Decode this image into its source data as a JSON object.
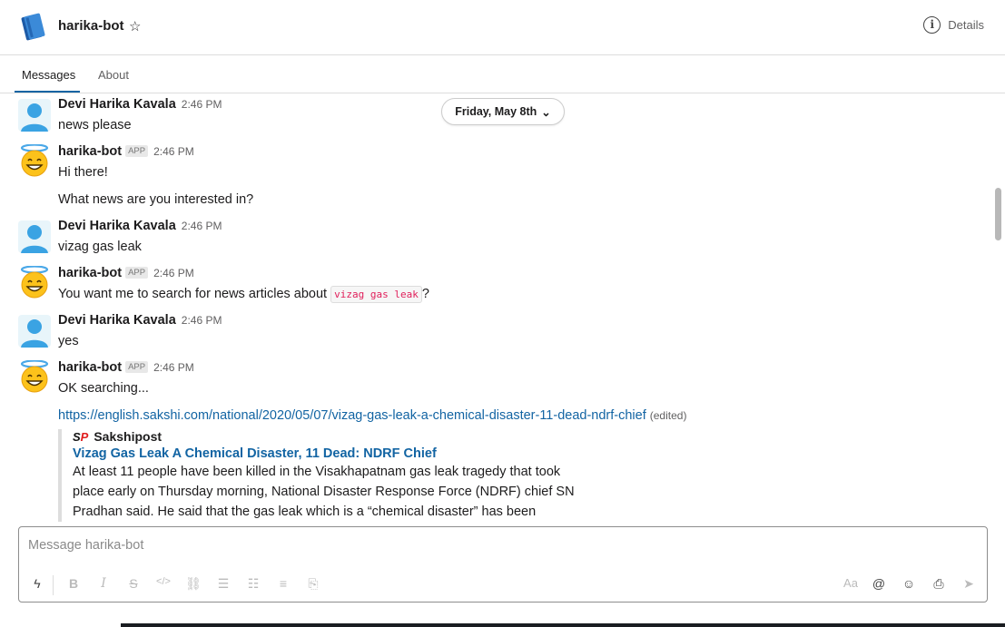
{
  "header": {
    "title": "harika-bot",
    "star_icon": "star-icon",
    "details_label": "Details"
  },
  "tabs": [
    {
      "label": "Messages",
      "active": true
    },
    {
      "label": "About",
      "active": false
    }
  ],
  "date_divider": "Friday, May 8th",
  "app_badge": "APP",
  "messages": [
    {
      "sender": "Devi Harika Kavala",
      "time": "2:46 PM",
      "is_bot": false,
      "lines": [
        "news please"
      ]
    },
    {
      "sender": "harika-bot",
      "time": "2:46 PM",
      "is_bot": true,
      "lines": [
        "Hi there!",
        "What news are you interested in?"
      ]
    },
    {
      "sender": "Devi Harika Kavala",
      "time": "2:46 PM",
      "is_bot": false,
      "lines": [
        "vizag gas leak"
      ]
    },
    {
      "sender": "harika-bot",
      "time": "2:46 PM",
      "is_bot": true,
      "text_before": "You want me to search for news articles about ",
      "code": "vizag gas leak",
      "text_after": "?"
    },
    {
      "sender": "Devi Harika Kavala",
      "time": "2:46 PM",
      "is_bot": false,
      "lines": [
        "yes"
      ]
    },
    {
      "sender": "harika-bot",
      "time": "2:46 PM",
      "is_bot": true,
      "lines": [
        "OK searching..."
      ],
      "link": "https://english.sakshi.com/national/2020/05/07/vizag-gas-leak-a-chemical-disaster-11-dead-ndrf-chief",
      "edited_label": "(edited)"
    }
  ],
  "attachment": {
    "logo_s": "S",
    "logo_p": "P",
    "source": "Sakshipost",
    "title": "Vizag Gas Leak A Chemical Disaster, 11 Dead: NDRF Chief",
    "body_lines": [
      "At least 11 people have been killed in the Visakhapatnam gas leak tragedy that took",
      "place early on Thursday morning, National Disaster Response Force (NDRF) chief SN",
      "Pradhan said. He said that the gas leak which is a “chemical disaster” has been"
    ]
  },
  "composer": {
    "placeholder": "Message harika-bot",
    "format_label": "Aa"
  },
  "colors": {
    "link": "#1264a3",
    "code": "#e01e5a",
    "tab_underline": "#1264a3"
  }
}
